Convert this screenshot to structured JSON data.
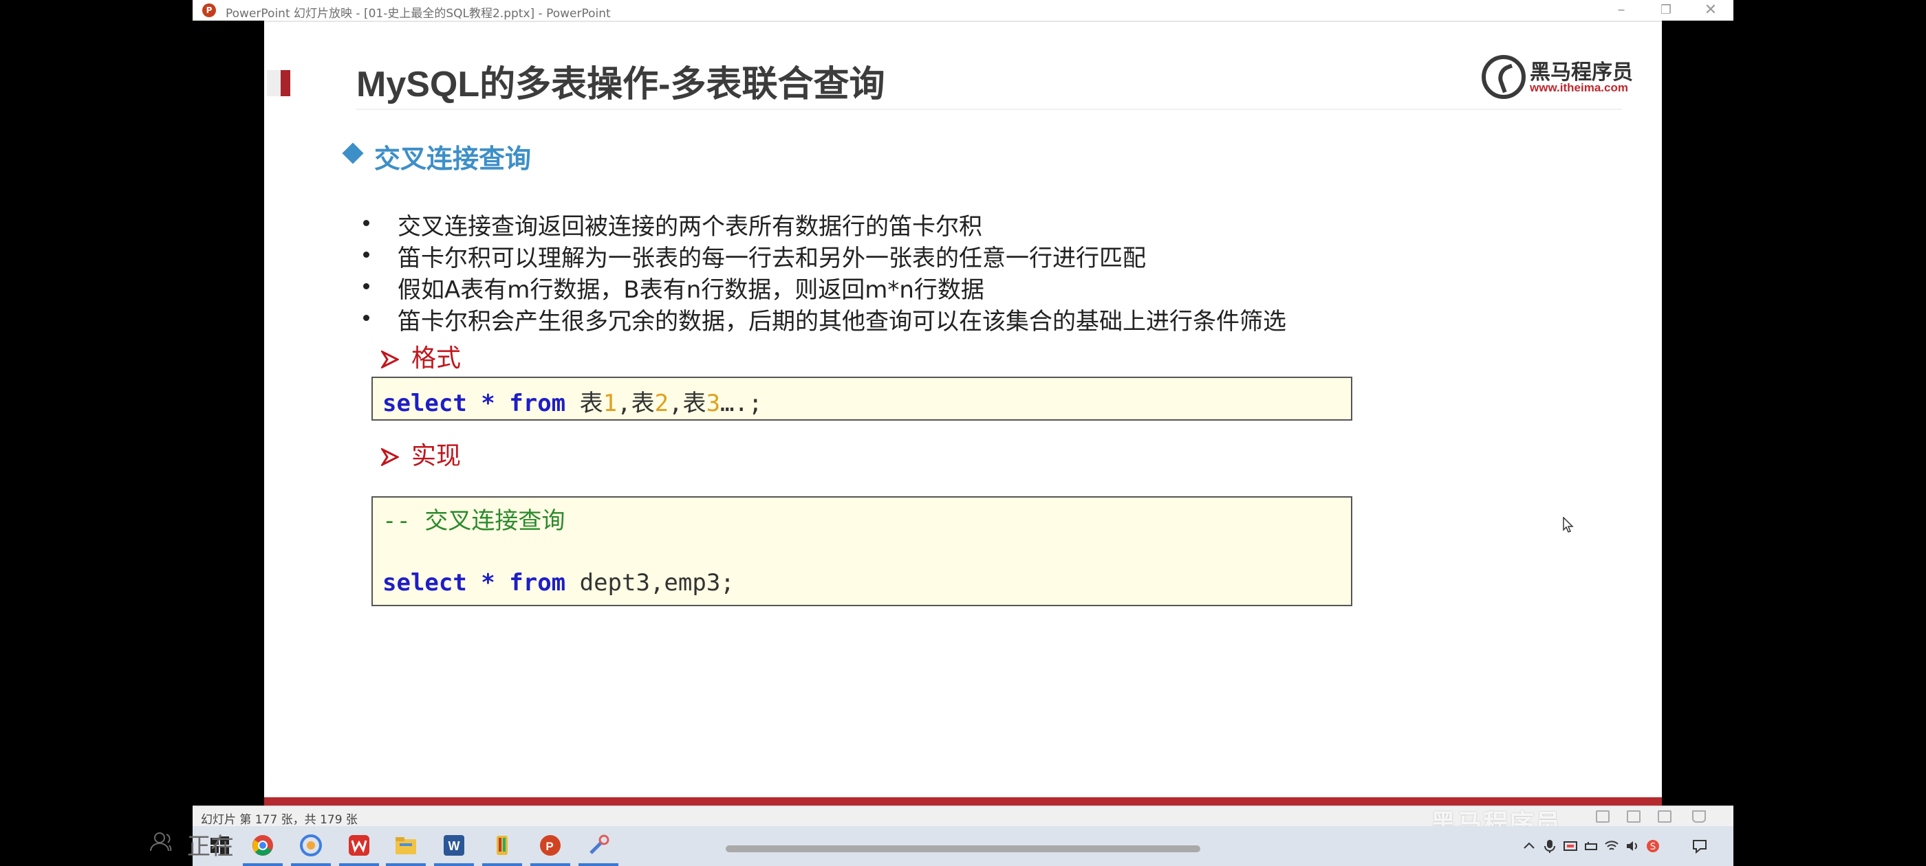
{
  "window": {
    "title": "PowerPoint 幻灯片放映 - [01-史上最全的SQL教程2.pptx] - PowerPoint",
    "app_icon_glyph": "P",
    "minimize": "–",
    "maximize": "❐",
    "close": "✕"
  },
  "slide": {
    "title": "MySQL的多表操作-多表联合查询",
    "logo_name": "黑马程序员",
    "logo_url": "www.itheima.com",
    "section_title": "交叉连接查询",
    "bullets": [
      "交叉连接查询返回被连接的两个表所有数据行的笛卡尔积",
      "笛卡尔积可以理解为一张表的每一行去和另外一张表的任意一行进行匹配",
      "假如A表有m行数据，B表有n行数据，则返回m*n行数据",
      "笛卡尔积会产生很多冗余的数据，后期的其他查询可以在该集合的基础上进行条件筛选"
    ],
    "format_heading": "格式",
    "format_code": {
      "kw1": "select",
      "star": " * ",
      "kw2": "from",
      "t1": " 表",
      "n1": "1",
      "t2": ",表",
      "n2": "2",
      "t3": ",表",
      "n3": "3",
      "tail": "….;"
    },
    "impl_heading": "实现",
    "impl_code": {
      "comment": "-- 交叉连接查询",
      "kw1": "select",
      "star": " * ",
      "kw2": "from",
      "tables": " dept3,emp3;"
    }
  },
  "status_bar": {
    "slide_info": "幻灯片 第 177 张，共 179 张",
    "watermark": "黑马程序员"
  },
  "overlay": {
    "text": "正在"
  },
  "colors": {
    "title_accent": "#a8232a",
    "section_blue": "#3d8fc8",
    "subhead_red": "#c0161d",
    "code_bg": "#fffde5",
    "keyword": "#1e1ec8",
    "number": "#e0a020",
    "comment": "#2c8a2c"
  },
  "taskbar": {
    "icons": [
      "windows-start-icon",
      "chrome-icon",
      "browser-icon",
      "wps-icon",
      "file-explorer-icon",
      "word-icon",
      "paint-icon",
      "powerpoint-icon",
      "tools-icon"
    ]
  }
}
